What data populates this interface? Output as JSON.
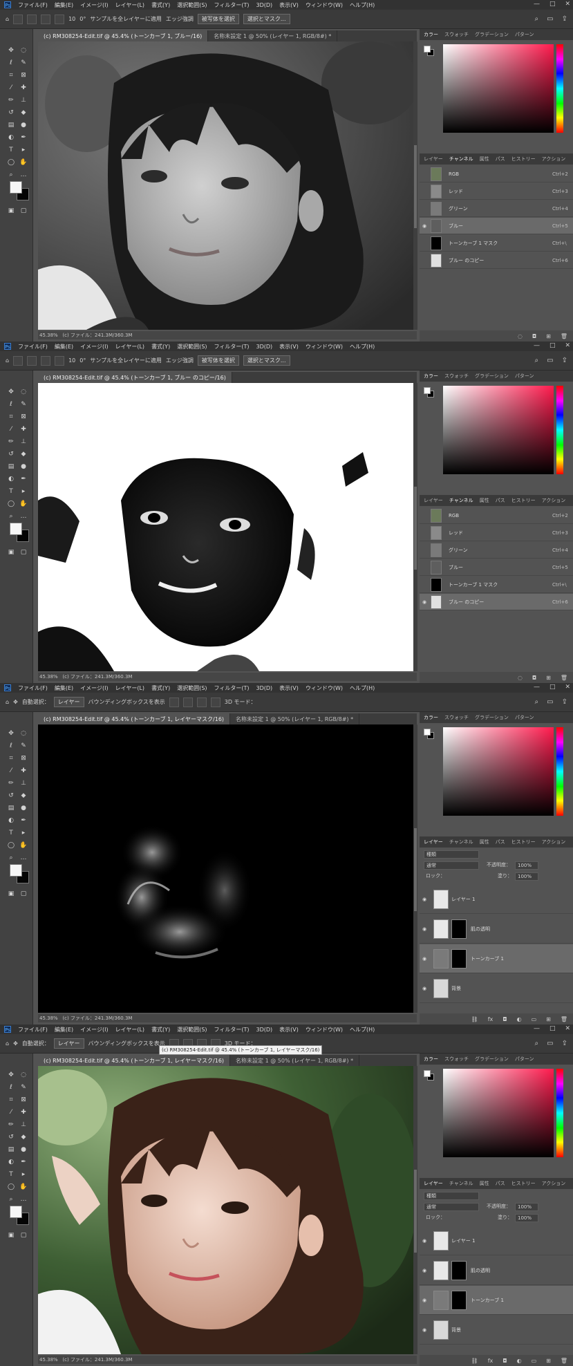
{
  "menu": [
    "ファイル(F)",
    "編集(E)",
    "イメージ(I)",
    "レイヤー(L)",
    "書式(Y)",
    "選択範囲(S)",
    "フィルター(T)",
    "3D(D)",
    "表示(V)",
    "ウィンドウ(W)",
    "ヘルプ(H)"
  ],
  "window_controls": [
    "—",
    "□",
    "✕"
  ],
  "options_brush": {
    "size": "10",
    "angle": "0°",
    "sample_label": "サンプルを全レイヤーに適用",
    "auto_enhance": "エッジ強調",
    "select_subject": "被写体を選択",
    "select_mask": "選択とマスク..."
  },
  "options_move": {
    "auto_select": "自動選択：",
    "target": "レイヤー",
    "transform": "バウンディングボックスを表示",
    "mode_3d": "3D モード："
  },
  "tabs_sheet1": [
    "(c) RM308254-Edit.tif @ 45.4% (トーンカーブ 1, ブルー/16)",
    "名称未設定 1 @ 50% (レイヤー 1, RGB/8#) *"
  ],
  "tabs_sheet2": [
    "(c) RM308254-Edit.tif @ 45.4% (トーンカーブ 1, ブルー のコピー/16)"
  ],
  "tabs_sheet34": [
    "(c) RM308254-Edit.tif @ 45.4% (トーンカーブ 1, レイヤーマスク/16)",
    "名称未設定 1 @ 50% (レイヤー 1, RGB/8#) *"
  ],
  "status": {
    "zoom": "45.38%",
    "doc": "(c) ファイル：241.3M/360.3M"
  },
  "panel_top_tabs": [
    "カラー",
    "スウォッチ",
    "グラデーション",
    "パターン"
  ],
  "channels_tabs": [
    "レイヤー",
    "チャンネル",
    "属性",
    "パス",
    "ヒストリー",
    "アクション"
  ],
  "channels": [
    {
      "name": "RGB",
      "key": "Ctrl+2"
    },
    {
      "name": "レッド",
      "key": "Ctrl+3"
    },
    {
      "name": "グリーン",
      "key": "Ctrl+4"
    },
    {
      "name": "ブルー",
      "key": "Ctrl+5"
    },
    {
      "name": "トーンカーブ 1 マスク",
      "key": "Ctrl+\\"
    },
    {
      "name": "ブルー のコピー",
      "key": "Ctrl+6"
    }
  ],
  "layers_tabs": [
    "レイヤー",
    "チャンネル",
    "属性",
    "パス",
    "ヒストリー",
    "アクション"
  ],
  "layer_kind": "種類",
  "blend_mode": "通常",
  "opacity_label": "不透明度：",
  "opacity_value": "100%",
  "lock_label": "ロック：",
  "fill_label": "塗り：",
  "fill_value": "100%",
  "layers": [
    {
      "name": "レイヤー 1"
    },
    {
      "name": "肌の透明"
    },
    {
      "name": "トーンカーブ 1"
    },
    {
      "name": "背景"
    }
  ],
  "tooltip": "(c) RM308254-Edit.tif @ 45.4% (トーンカーブ 1, レイヤーマスク/16)",
  "colors": {
    "ui_dark": "#323232",
    "ui_mid": "#535353",
    "accent": "#ff1a4d"
  }
}
